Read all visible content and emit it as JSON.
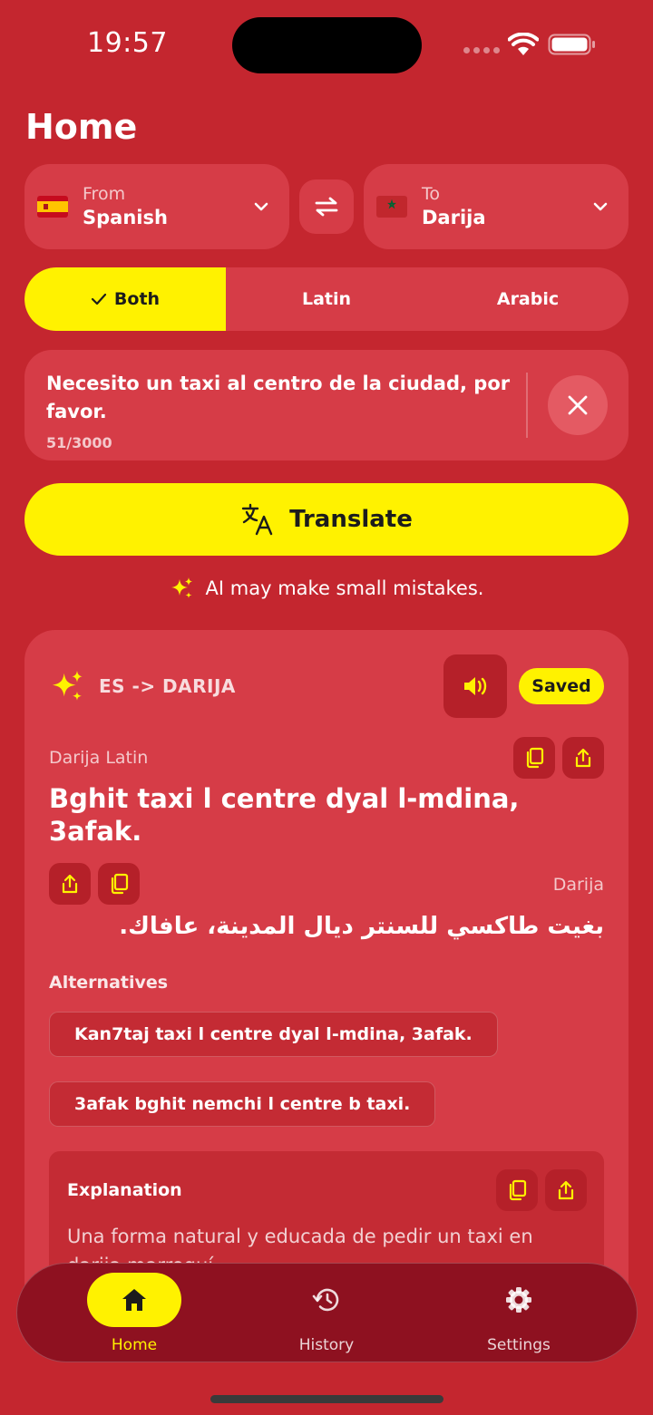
{
  "status_bar": {
    "time": "19:57"
  },
  "header": {
    "title": "Home"
  },
  "from": {
    "caption": "From",
    "language": "Spanish",
    "flag_icon": "spain-flag-icon"
  },
  "to": {
    "caption": "To",
    "language": "Darija",
    "flag_icon": "morocco-flag-icon"
  },
  "script_options": {
    "selected": "Both",
    "items": [
      {
        "label": "Both"
      },
      {
        "label": "Latin"
      },
      {
        "label": "Arabic"
      }
    ]
  },
  "input": {
    "value": "Necesito un taxi al centro de la ciudad, por favor.",
    "count": "51/3000"
  },
  "translate_button": {
    "label": "Translate"
  },
  "disclaimer": "AI may make small mistakes.",
  "result": {
    "route": "ES -> DARIJA",
    "saved_label": "Saved",
    "latin_label": "Darija Latin",
    "latin_text": "Bghit taxi l centre dyal l-mdina, 3afak.",
    "arabic_label": "Darija",
    "arabic_text": "بغيت طاكسي للسنتر ديال المدينة، عافاك.",
    "alternatives_title": "Alternatives",
    "alternatives": [
      "Kan7taj taxi l centre dyal l-mdina, 3afak.",
      "3afak bghit nemchi l centre b taxi."
    ],
    "explanation_title": "Explanation",
    "explanation_text": "Una forma natural y educada de pedir un taxi en darija marroquí."
  },
  "nav": {
    "items": [
      {
        "label": "Home"
      },
      {
        "label": "History"
      },
      {
        "label": "Settings"
      }
    ]
  },
  "colors": {
    "background": "#c4262f",
    "card": "#d63c47",
    "accent": "#fff200",
    "nav": "#8e1120"
  }
}
